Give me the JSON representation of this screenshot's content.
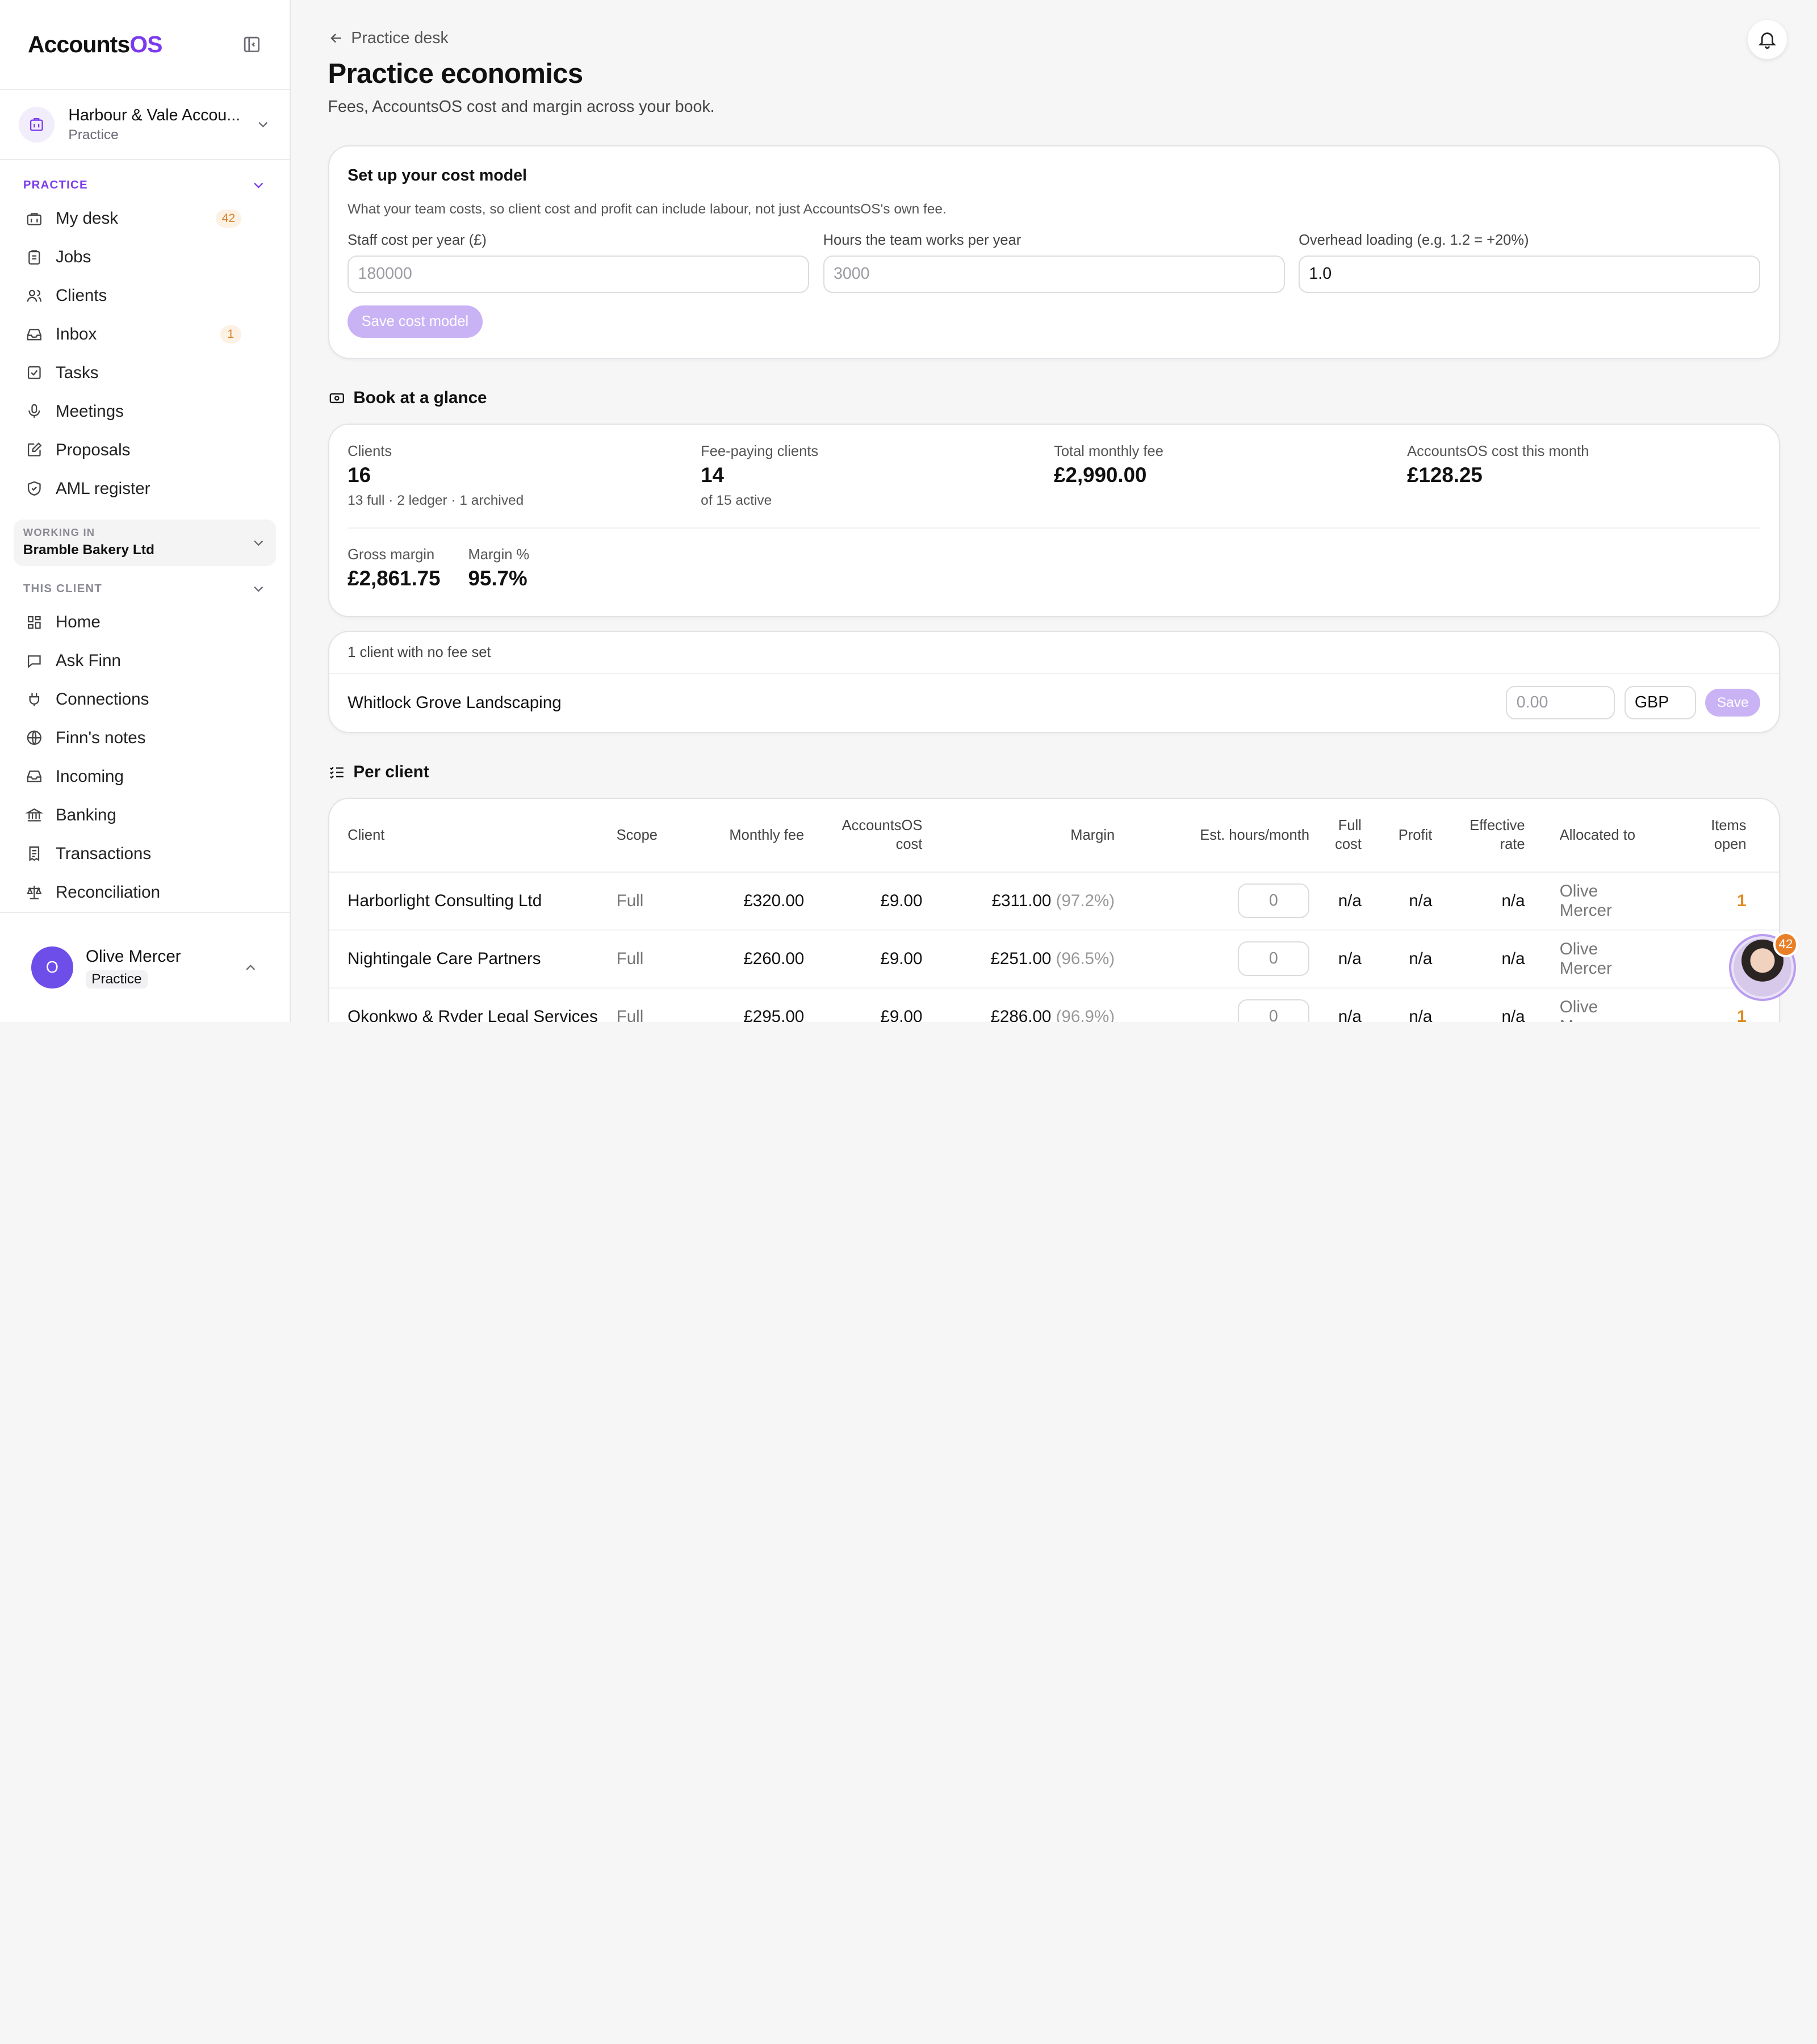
{
  "brand": {
    "prefix": "Accounts",
    "suffix": "OS"
  },
  "practice": {
    "name": "Harbour & Vale Accou...",
    "role": "Practice"
  },
  "nav": {
    "practice_label": "PRACTICE",
    "practice_items": [
      {
        "label": "My desk",
        "icon": "briefcase-icon",
        "badge": "42"
      },
      {
        "label": "Jobs",
        "icon": "clipboard-icon"
      },
      {
        "label": "Clients",
        "icon": "users-icon"
      },
      {
        "label": "Inbox",
        "icon": "inbox-icon",
        "badge": "1"
      },
      {
        "label": "Tasks",
        "icon": "checkbox-icon"
      },
      {
        "label": "Meetings",
        "icon": "microphone-icon"
      },
      {
        "label": "Proposals",
        "icon": "edit-icon"
      },
      {
        "label": "AML register",
        "icon": "shield-icon"
      }
    ],
    "working_in_label": "WORKING IN",
    "working_in_value": "Bramble Bakery Ltd",
    "client_label": "THIS CLIENT",
    "client_items": [
      {
        "label": "Home",
        "icon": "grid-icon"
      },
      {
        "label": "Ask Finn",
        "icon": "chat-icon"
      },
      {
        "label": "Connections",
        "icon": "plug-icon"
      },
      {
        "label": "Finn's notes",
        "icon": "globe-icon"
      },
      {
        "label": "Incoming",
        "icon": "inbox-icon"
      },
      {
        "label": "Banking",
        "icon": "bank-icon"
      },
      {
        "label": "Transactions",
        "icon": "receipt-icon"
      },
      {
        "label": "Reconciliation",
        "icon": "scales-icon"
      }
    ]
  },
  "user": {
    "initial": "O",
    "name": "Olive Mercer",
    "role": "Practice"
  },
  "header": {
    "back_label": "Practice desk",
    "title": "Practice economics",
    "subtitle": "Fees, AccountsOS cost and margin across your book."
  },
  "cost_model": {
    "title": "Set up your cost model",
    "description": "What your team costs, so client cost and profit can include labour, not just AccountsOS's own fee.",
    "staff_cost_label": "Staff cost per year (£)",
    "staff_cost_placeholder": "180000",
    "hours_label": "Hours the team works per year",
    "hours_placeholder": "3000",
    "overhead_label": "Overhead loading (e.g. 1.2 = +20%)",
    "overhead_value": "1.0",
    "save_label": "Save cost model"
  },
  "glance": {
    "title": "Book at a glance",
    "clients_label": "Clients",
    "clients_value": "16",
    "clients_sub": "13 full · 2 ledger · 1 archived",
    "fee_paying_label": "Fee-paying clients",
    "fee_paying_value": "14",
    "fee_paying_sub": "of 15 active",
    "monthly_fee_label": "Total monthly fee",
    "monthly_fee_value": "£2,990.00",
    "aos_cost_label": "AccountsOS cost this month",
    "aos_cost_value": "£128.25",
    "gross_margin_label": "Gross margin",
    "gross_margin_value": "£2,861.75",
    "margin_pct_label": "Margin %",
    "margin_pct_value": "95.7%"
  },
  "no_fee": {
    "heading": "1 client with no fee set",
    "client": "Whitlock Grove Landscaping",
    "fee_placeholder": "0.00",
    "currency": "GBP",
    "save_label": "Save"
  },
  "per_client": {
    "title": "Per client",
    "headers": {
      "client": "Client",
      "scope": "Scope",
      "monthly_fee": "Monthly fee",
      "aos_cost_1": "AccountsOS",
      "aos_cost_2": "cost",
      "margin": "Margin",
      "hours": "Est. hours/month",
      "full_cost_1": "Full",
      "full_cost_2": "cost",
      "profit": "Profit",
      "eff_rate_1": "Effective",
      "eff_rate_2": "rate",
      "allocated": "Allocated to",
      "items_1": "Items",
      "items_2": "open"
    },
    "rows": [
      {
        "client": "Harborlight Consulting Ltd",
        "scope": "Full",
        "fee": "£320.00",
        "cost": "£9.00",
        "margin": "£311.00",
        "margin_pct": "(97.2%)",
        "hours": "0",
        "full_cost": "n/a",
        "profit": "n/a",
        "rate": "n/a",
        "allocated": "Olive Mercer",
        "items": "1"
      },
      {
        "client": "Nightingale Care Partners",
        "scope": "Full",
        "fee": "£260.00",
        "cost": "£9.00",
        "margin": "£251.00",
        "margin_pct": "(96.5%)",
        "hours": "0",
        "full_cost": "n/a",
        "profit": "n/a",
        "rate": "n/a",
        "allocated": "Olive Mercer",
        "items": "1"
      },
      {
        "client": "Okonkwo & Ryder Legal Services",
        "scope": "Full",
        "fee": "£295.00",
        "cost": "£9.00",
        "margin": "£286.00",
        "margin_pct": "(96.9%)",
        "hours": "0",
        "full_cost": "n/a",
        "profit": "n/a",
        "rate": "n/a",
        "allocated": "Olive Mercer",
        "items": "1"
      }
    ]
  },
  "helper": {
    "badge": "42"
  },
  "colors": {
    "accent": "#7c3aed",
    "badge_orange": "#e08a1e",
    "button_disabled": "#c9b3f5"
  }
}
